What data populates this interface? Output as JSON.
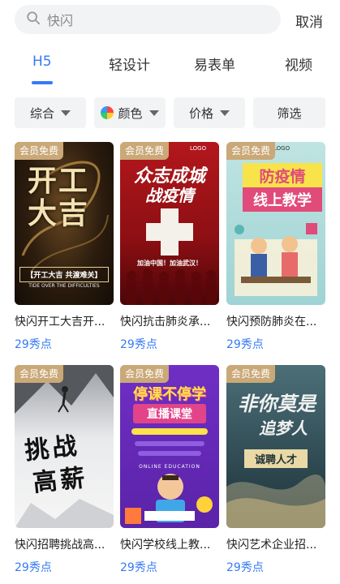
{
  "search": {
    "value": "快闪",
    "cancel_label": "取消"
  },
  "tabs": [
    {
      "label": "H5",
      "active": true
    },
    {
      "label": "轻设计",
      "active": false
    },
    {
      "label": "易表单",
      "active": false
    },
    {
      "label": "视频",
      "active": false
    }
  ],
  "filters": [
    {
      "label": "综合"
    },
    {
      "label": "颜色"
    },
    {
      "label": "价格"
    },
    {
      "label": "筛选"
    }
  ],
  "cards": [
    {
      "badge": "会员免费",
      "title": "快闪开工大吉开...",
      "price": "29秀点",
      "poster": {
        "main": "开工大吉",
        "sub": "【开工大吉 共渡难关】",
        "en": "TIDE OVER THE DIFFICULTIES"
      }
    },
    {
      "badge": "会员免费",
      "title": "快闪抗击肺炎承...",
      "price": "29秀点",
      "poster": {
        "main": "众志成城",
        "sub": "战疫情",
        "line": "加油中国！加油武汉！",
        "logo": "LOGO"
      }
    },
    {
      "badge": "会员免费",
      "title": "快闪预防肺炎在...",
      "price": "29秀点",
      "poster": {
        "main": "防疫情",
        "sub": "线上教学",
        "logo": "LOGO"
      }
    },
    {
      "badge": "会员免费",
      "title": "快闪招聘挑战高...",
      "price": "29秀点",
      "poster": {
        "main": "挑战",
        "sub": "高薪"
      }
    },
    {
      "badge": "会员免费",
      "title": "快闪学校线上教...",
      "price": "29秀点",
      "poster": {
        "main": "停课不停学",
        "sub": "直播课堂",
        "en": "ONLINE EDUCATION"
      }
    },
    {
      "badge": "会员免费",
      "title": "快闪艺术企业招...",
      "price": "29秀点",
      "poster": {
        "main": "非你莫是",
        "sub": "追梦人",
        "line": "诚聘人才"
      }
    }
  ],
  "colors": {
    "accent": "#3579f6",
    "badge": "#caa878"
  }
}
